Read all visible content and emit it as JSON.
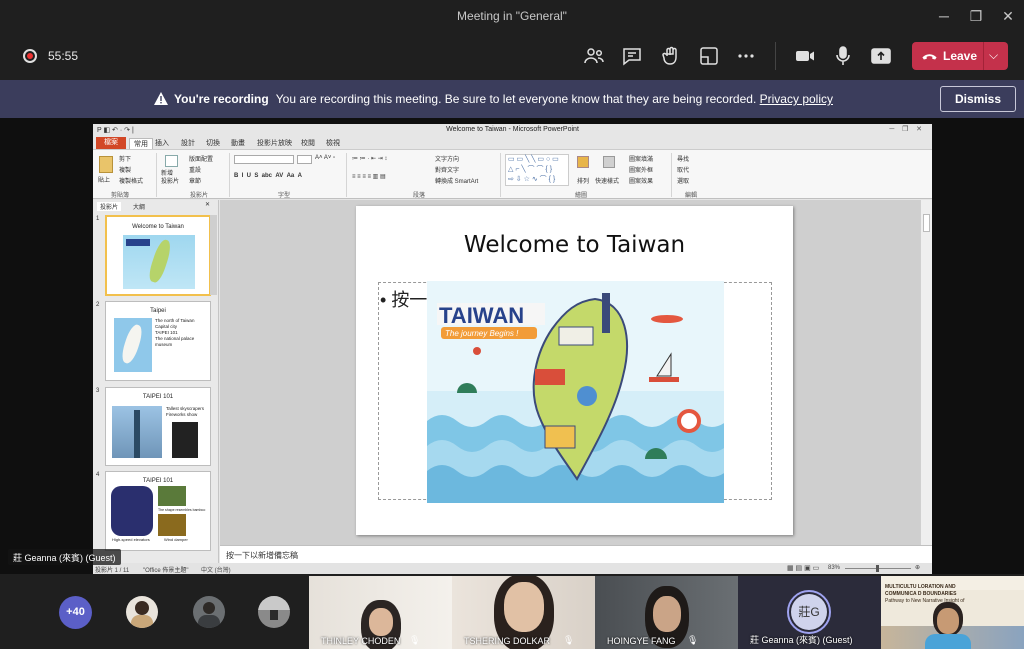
{
  "window": {
    "title": "Meeting in \"General\""
  },
  "toolbar": {
    "timer": "55:55",
    "leave_label": "Leave"
  },
  "banner": {
    "heading": "You're recording",
    "message": "You are recording this meeting. Be sure to let everyone know that they are being recorded.",
    "link": "Privacy policy",
    "dismiss_label": "Dismiss"
  },
  "ppt": {
    "window_title": "Welcome to Taiwan - Microsoft PowerPoint",
    "qat": "P ◧ ↶ · ↷ |",
    "tabs": [
      "檔案",
      "常用",
      "插入",
      "設計",
      "切換",
      "動畫",
      "投影片放映",
      "校閱",
      "檢視"
    ],
    "groups": [
      "剪貼簿",
      "投影片",
      "字型",
      "段落",
      "繪圖",
      "編輯"
    ],
    "ribbon_items": {
      "paste": "貼上",
      "cut": "剪下",
      "copy": "複製",
      "format_painter": "複製格式",
      "new_slide": "新增\n投影片",
      "layout": "版面配置",
      "reset": "重設",
      "section": "章節",
      "text_direction": "文字方向",
      "align_text": "對齊文字",
      "smartart": "轉換成 SmartArt",
      "arrange": "排列",
      "quick_styles": "快速樣式",
      "shape_fill": "圖案填滿",
      "shape_outline": "圖案外框",
      "shape_effects": "圖案效果",
      "find": "尋找",
      "replace": "取代",
      "select": "選取"
    },
    "pane_tabs": [
      "投影片",
      "大綱"
    ],
    "thumbnails": [
      {
        "num": "1",
        "title": "Welcome to Taiwan"
      },
      {
        "num": "2",
        "title": "Taipei",
        "lines": [
          "The north of Taiwan",
          "Capital city",
          "TAIPEI 101",
          "The national palace",
          "museum"
        ]
      },
      {
        "num": "3",
        "title": "TAIPEI 101",
        "lines": [
          "Tallest skyscrapers",
          "Fireworks show"
        ]
      },
      {
        "num": "4",
        "title": "TAIPEI 101",
        "lines": [
          "High-speed elevators",
          "Wind damper",
          "The shape resembles bamboo"
        ]
      }
    ],
    "slide": {
      "title": "Welcome to Taiwan",
      "bullet": "按一",
      "map_title": "TAIWAN",
      "map_subtitle": "The journey Begins !"
    },
    "notes": "按一下以新增備忘稿",
    "status": {
      "slide_info": "投影片 1 / 11",
      "theme": "\"Office 佈景主題\"",
      "language": "中文 (台灣)",
      "zoom": "83%"
    }
  },
  "presenter_label": "莊 Geanna (來賓) (Guest)",
  "gallery": {
    "more_count": "+40",
    "tiles": [
      {
        "name": "THINLEY CHODEN"
      },
      {
        "name": "TSHERING DOLKAR"
      },
      {
        "name": "HOINGYE FANG"
      },
      {
        "name": "莊 Geanna (來賓) (Guest)",
        "initials": "莊G"
      }
    ],
    "share_text": {
      "line1": "MULTICULTU   LORATION AND",
      "line2": "COMMUNICA   D BOUNDARIES",
      "line3": "Pathway to New   Narrative Insight of"
    }
  },
  "colors": {
    "leave": "#c4314b",
    "banner": "#3b3d5c",
    "accent": "#5b5fc7",
    "ppt_file_tab": "#d24726"
  }
}
